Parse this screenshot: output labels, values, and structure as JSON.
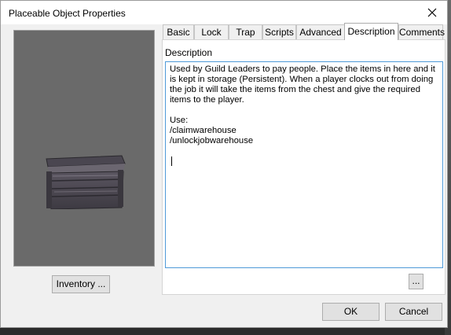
{
  "window": {
    "title": "Placeable Object Properties",
    "close_glyph": "✕"
  },
  "tabs": [
    {
      "label": "Basic",
      "active": false
    },
    {
      "label": "Lock",
      "active": false
    },
    {
      "label": "Trap",
      "active": false
    },
    {
      "label": "Scripts",
      "active": false
    },
    {
      "label": "Advanced",
      "active": false
    },
    {
      "label": "Description",
      "active": true
    },
    {
      "label": "Comments",
      "active": false
    }
  ],
  "description_tab": {
    "label": "Description",
    "text": "Used by Guild Leaders to pay people. Place the items in here and it is kept in storage (Persistent). When a player clocks out from doing the job it will take the items from the chest and give the required items to the player.\n\nUse:\n/claimwarehouse\n/unlockjobwarehouse",
    "browse_label": "..."
  },
  "preview": {
    "icon": "chest-model-icon",
    "inventory_label": "Inventory ..."
  },
  "buttons": {
    "ok_label": "OK",
    "cancel_label": "Cancel"
  },
  "colors": {
    "accent_border": "#4f9ad8",
    "preview_bg": "#6a6a6a"
  }
}
